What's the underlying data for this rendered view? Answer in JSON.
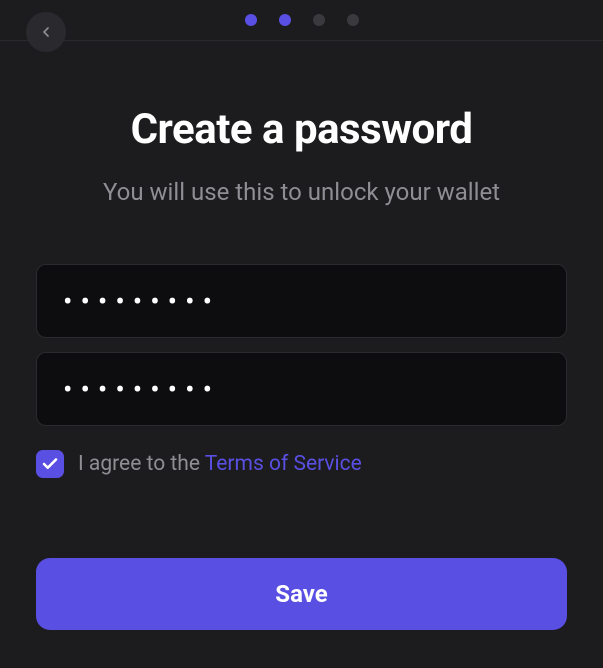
{
  "header": {
    "steps": {
      "total": 4,
      "active_indices": [
        0,
        1
      ]
    }
  },
  "page": {
    "title": "Create a password",
    "subtitle": "You will use this to unlock your wallet"
  },
  "form": {
    "password_value": "•••••••••",
    "confirm_value": "•••••••••",
    "terms_prefix": "I agree to the ",
    "terms_link_text": "Terms of Service",
    "checkbox_checked": true,
    "save_label": "Save"
  },
  "colors": {
    "accent": "#5a4fe3",
    "bg": "#1c1c1f",
    "input_bg": "#0d0d0f",
    "muted": "#8e8e93"
  }
}
